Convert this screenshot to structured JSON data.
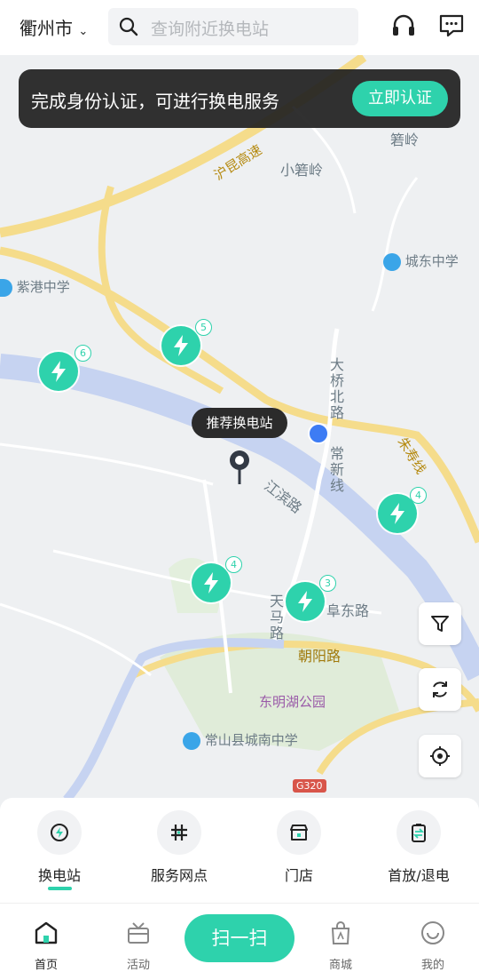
{
  "header": {
    "city": "衢州市",
    "search_placeholder": "查询附近换电站"
  },
  "banner": {
    "text": "完成身份认证，可进行换电服务",
    "button": "立即认证"
  },
  "map": {
    "labels": {
      "hukun": "沪昆高速",
      "xiaoshouling": "小箬岭",
      "shouling": "箬岭",
      "chengdong": "城东中学",
      "zigang": "紫港中学",
      "daqiao": "大桥北路",
      "changxin": "常新线",
      "zhushou": "朱寿线",
      "jiangbin": "江滨路",
      "tianma": "天马路",
      "fudong": "阜东路",
      "chaoyang": "朝阳路",
      "dongminghu": "东明湖公园",
      "chengnan": "常山县城南中学",
      "g320": "G320"
    },
    "tooltip": "推荐换电站",
    "stations": [
      {
        "count": "6"
      },
      {
        "count": "5"
      },
      {
        "count": "4"
      },
      {
        "count": "4"
      },
      {
        "count": "3"
      }
    ]
  },
  "services": [
    {
      "label": "换电站",
      "icon": "swap-station-icon"
    },
    {
      "label": "服务网点",
      "icon": "service-point-icon"
    },
    {
      "label": "门店",
      "icon": "store-icon"
    },
    {
      "label": "首放/退电",
      "icon": "battery-return-icon"
    }
  ],
  "tabs": [
    {
      "label": "首页",
      "icon": "home-icon"
    },
    {
      "label": "活动",
      "icon": "activity-icon"
    },
    {
      "label": "扫一扫"
    },
    {
      "label": "商城",
      "icon": "shop-bag-icon"
    },
    {
      "label": "我的",
      "icon": "profile-icon"
    }
  ],
  "colors": {
    "accent": "#2ed2ac",
    "river": "#c6d3f1",
    "highway": "#f5dc8b",
    "park": "#e0ecd9"
  }
}
